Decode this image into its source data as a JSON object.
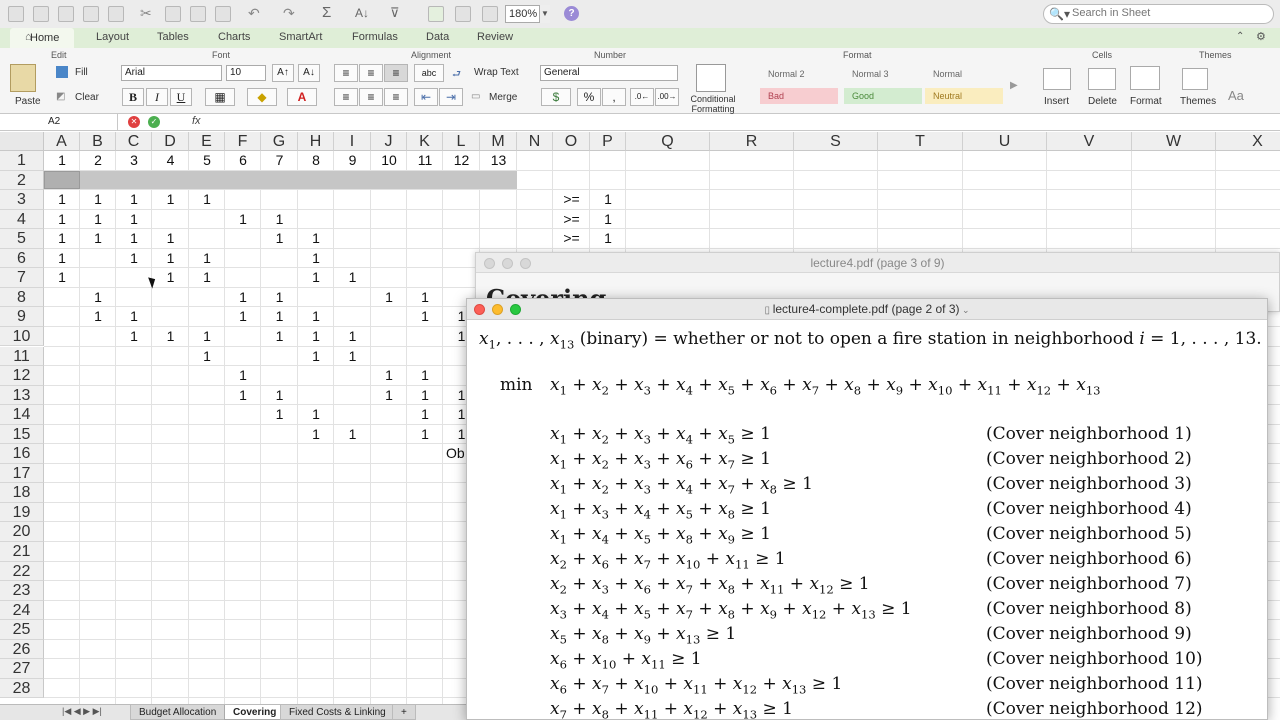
{
  "toolbar": {
    "zoom": "180%",
    "search_placeholder": "Search in Sheet",
    "help": "?"
  },
  "ribbon_tabs": [
    "Home",
    "Layout",
    "Tables",
    "Charts",
    "SmartArt",
    "Formulas",
    "Data",
    "Review"
  ],
  "ribbon": {
    "groups": {
      "edit": "Edit",
      "font": "Font",
      "alignment": "Alignment",
      "number": "Number",
      "format": "Format",
      "cells": "Cells",
      "themes": "Themes"
    },
    "paste": "Paste",
    "fill": "Fill",
    "clear": "Clear",
    "font_name": "Arial",
    "font_size": "10",
    "bold": "B",
    "italic": "I",
    "underline": "U",
    "wrap_text": "Wrap Text",
    "abc": "abc",
    "merge": "Merge",
    "number_format": "General",
    "percent": "%",
    "comma": ",",
    "conditional_formatting": "Conditional Formatting",
    "styles": [
      {
        "label": "Normal 2",
        "bg": "#f5f5f5",
        "color": "#666"
      },
      {
        "label": "Normal 3",
        "bg": "#f5f5f5",
        "color": "#666"
      },
      {
        "label": "Normal",
        "bg": "#f5f5f5",
        "color": "#666"
      },
      {
        "label": "Bad",
        "bg": "#f7cdd0",
        "color": "#b04050"
      },
      {
        "label": "Good",
        "bg": "#d3ecd0",
        "color": "#4a8a3a"
      },
      {
        "label": "Neutral",
        "bg": "#faedbf",
        "color": "#a07a20"
      }
    ],
    "insert": "Insert",
    "delete": "Delete",
    "format_btn": "Format",
    "themes_btn": "Themes",
    "aa": "Aa"
  },
  "formula_bar": {
    "name_box": "A2",
    "fx": "fx",
    "formula": ""
  },
  "grid": {
    "columns": [
      "A",
      "B",
      "C",
      "D",
      "E",
      "F",
      "G",
      "H",
      "I",
      "J",
      "K",
      "L",
      "M",
      "N",
      "O",
      "P",
      "Q",
      "R",
      "S",
      "T",
      "U",
      "V",
      "W",
      "X"
    ],
    "rows": [
      "1",
      "2",
      "3",
      "4",
      "5",
      "6",
      "7",
      "8",
      "9",
      "10",
      "11",
      "12",
      "13",
      "14",
      "15",
      "16",
      "17",
      "18",
      "19",
      "20",
      "21",
      "22",
      "23",
      "24",
      "25",
      "26",
      "27",
      "28"
    ],
    "row1": [
      "1",
      "2",
      "3",
      "4",
      "5",
      "6",
      "7",
      "8",
      "9",
      "10",
      "11",
      "12",
      "13"
    ],
    "matrix": [
      [
        1,
        1,
        1,
        1,
        1,
        0,
        0,
        0,
        0,
        0,
        0,
        0,
        0
      ],
      [
        1,
        1,
        1,
        0,
        0,
        1,
        1,
        0,
        0,
        0,
        0,
        0,
        0
      ],
      [
        1,
        1,
        1,
        1,
        0,
        0,
        1,
        1,
        0,
        0,
        0,
        0,
        0
      ],
      [
        1,
        0,
        1,
        1,
        1,
        0,
        0,
        1,
        0,
        0,
        0,
        0,
        0
      ],
      [
        1,
        0,
        0,
        1,
        1,
        0,
        0,
        1,
        1,
        0,
        0,
        0,
        0
      ],
      [
        0,
        1,
        0,
        0,
        0,
        1,
        1,
        0,
        0,
        1,
        1,
        0,
        0
      ],
      [
        0,
        1,
        1,
        0,
        0,
        1,
        1,
        1,
        0,
        0,
        1,
        1,
        0
      ],
      [
        0,
        0,
        1,
        1,
        1,
        0,
        1,
        1,
        1,
        0,
        0,
        1,
        0
      ],
      [
        0,
        0,
        0,
        0,
        1,
        0,
        0,
        1,
        1,
        0,
        0,
        0,
        0
      ],
      [
        0,
        0,
        0,
        0,
        0,
        1,
        0,
        0,
        0,
        1,
        1,
        0,
        0
      ],
      [
        0,
        0,
        0,
        0,
        0,
        1,
        1,
        0,
        0,
        1,
        1,
        1,
        0
      ],
      [
        0,
        0,
        0,
        0,
        0,
        0,
        1,
        1,
        0,
        0,
        1,
        1,
        0
      ],
      [
        0,
        0,
        0,
        0,
        0,
        0,
        0,
        1,
        1,
        0,
        1,
        1,
        0
      ]
    ],
    "constraints": [
      {
        "op": ">=",
        "rhs": "1"
      },
      {
        "op": ">=",
        "rhs": "1"
      },
      {
        "op": ">=",
        "rhs": "1"
      }
    ],
    "obj_label": "Ob"
  },
  "sheet_tabs": [
    "Budget Allocation",
    "Covering",
    "Fixed Costs & Linking",
    "+"
  ],
  "active_sheet": "Covering",
  "pdf_back": {
    "title": "lecture4.pdf (page 3 of 9)",
    "heading": "Covering"
  },
  "pdf_front": {
    "title": "lecture4-complete.pdf (page 2 of 3)",
    "intro": "(binary) = whether or not to open a fire station in neighborhood",
    "min": "min",
    "constraint_vars": [
      [
        1,
        2,
        3,
        4,
        5
      ],
      [
        1,
        2,
        3,
        6,
        7
      ],
      [
        1,
        2,
        3,
        4,
        7,
        8
      ],
      [
        1,
        3,
        4,
        5,
        8
      ],
      [
        1,
        4,
        5,
        8,
        9
      ],
      [
        2,
        6,
        7,
        10,
        11
      ],
      [
        2,
        3,
        6,
        7,
        8,
        11,
        12
      ],
      [
        3,
        4,
        5,
        7,
        8,
        9,
        12,
        13
      ],
      [
        5,
        8,
        9,
        13
      ],
      [
        6,
        10,
        11
      ],
      [
        6,
        7,
        10,
        11,
        12,
        13
      ],
      [
        7,
        8,
        11,
        12,
        13
      ]
    ],
    "labels": [
      "(Cover neighborhood 1)",
      "(Cover neighborhood 2)",
      "(Cover neighborhood 3)",
      "(Cover neighborhood 4)",
      "(Cover neighborhood 5)",
      "(Cover neighborhood 6)",
      "(Cover neighborhood 7)",
      "(Cover neighborhood 8)",
      "(Cover neighborhood 9)",
      "(Cover neighborhood 10)",
      "(Cover neighborhood 11)",
      "(Cover neighborhood 12)"
    ]
  }
}
